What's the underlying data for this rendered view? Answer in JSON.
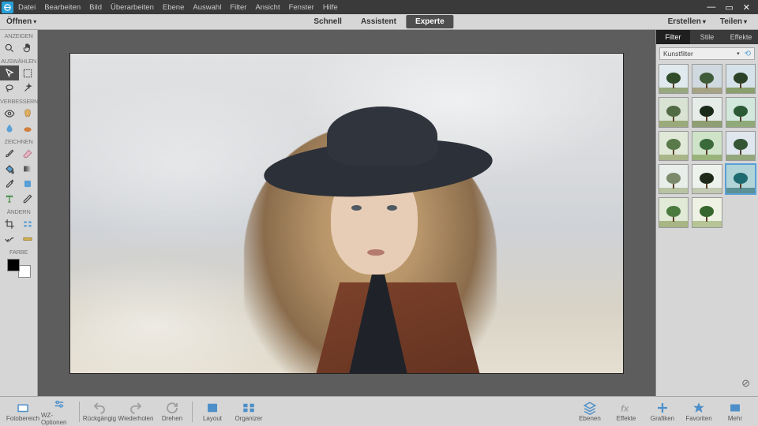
{
  "menu": {
    "items": [
      "Datei",
      "Bearbeiten",
      "Bild",
      "Überarbeiten",
      "Ebene",
      "Auswahl",
      "Filter",
      "Ansicht",
      "Fenster",
      "Hilfe"
    ]
  },
  "actionbar": {
    "open": "Öffnen",
    "modes": [
      "Schnell",
      "Assistent",
      "Experte"
    ],
    "active_mode": 2,
    "create": "Erstellen",
    "share": "Teilen"
  },
  "toolbox": {
    "sections": {
      "view": "ANZEIGEN",
      "select": "AUSWÄHLEN",
      "enhance": "VERBESSERN",
      "draw": "ZEICHNEN",
      "modify": "ÄNDERN",
      "color": "FARBE"
    }
  },
  "rpanel": {
    "tabs": [
      "Filter",
      "Stile",
      "Effekte"
    ],
    "active_tab": 0,
    "dropdown": "Kunstfilter",
    "thumb_count": 14,
    "selected_thumb": 11
  },
  "bottombar": {
    "left": [
      "Fotobereich",
      "WZ-Optionen",
      "Rückgängig",
      "Wiederholen",
      "Drehen",
      "Layout",
      "Organizer"
    ],
    "right": [
      "Ebenen",
      "Effekte",
      "Grafiken",
      "Favoriten",
      "Mehr"
    ]
  },
  "thumb_styles": [
    {
      "sky": "#dfe9ee",
      "grnd": "#97a77e",
      "can": "#2f4d2a"
    },
    {
      "sky": "#cfd9df",
      "grnd": "#a5a384",
      "can": "#3f5c39"
    },
    {
      "sky": "#d6e2ea",
      "grnd": "#8aa06c",
      "can": "#2c4226"
    },
    {
      "sky": "#d9e3d4",
      "grnd": "#9baa7b",
      "can": "#536b45"
    },
    {
      "sky": "#e6ece8",
      "grnd": "#8f9f73",
      "can": "#1a2a18"
    },
    {
      "sky": "#d2e8dc",
      "grnd": "#90aa7a",
      "can": "#2c5a34"
    },
    {
      "sky": "#e0e8d8",
      "grnd": "#aab58a",
      "can": "#5a7a4b"
    },
    {
      "sky": "#cfe3c9",
      "grnd": "#9ab37a",
      "can": "#3a6a3a"
    },
    {
      "sky": "#dfe6ee",
      "grnd": "#93a77d",
      "can": "#355535"
    },
    {
      "sky": "#e8eeea",
      "grnd": "#b8c3a2",
      "can": "#7a8a6a"
    },
    {
      "sky": "#eef2ed",
      "grnd": "#c3c9b2",
      "can": "#1d2a1a"
    },
    {
      "sky": "#b0d4d8",
      "grnd": "#5a9096",
      "can": "#1d6a70"
    },
    {
      "sky": "#e0ead6",
      "grnd": "#a7b684",
      "can": "#4a7a3e"
    },
    {
      "sky": "#eef2e4",
      "grnd": "#b6c496",
      "can": "#36662f"
    }
  ]
}
